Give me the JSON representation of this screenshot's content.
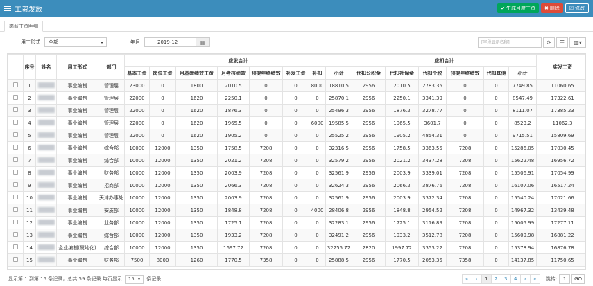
{
  "header": {
    "title": "工资发放",
    "btn_generate": "✔ 生成月度工资",
    "btn_delete": "✖ 删除",
    "btn_edit": "☑ 修改"
  },
  "tabs": [
    {
      "label": "岗薪工资明细"
    }
  ],
  "filters": {
    "employment_label": "用工形式",
    "employment_value": "全部",
    "month_label": "年月",
    "month_value": "2019-12",
    "search_placeholder": "[字段显示名称]"
  },
  "table": {
    "group_headers": {
      "payable": "应发合计",
      "deduct": "应扣合计"
    },
    "headers": {
      "seq": "序号",
      "name": "姓名",
      "employment": "用工形式",
      "dept": "部门",
      "pay": [
        "基本工资",
        "岗位工资",
        "月基础绩效工资",
        "月考核绩效",
        "预提年终绩效",
        "补发工资",
        "补扣",
        "小计"
      ],
      "ded": [
        "代扣公积金",
        "代扣社保金",
        "代扣个税",
        "预提年终绩效",
        "代扣其他",
        "小计"
      ],
      "net": "实发工资"
    },
    "rows": [
      {
        "seq": "1",
        "type": "事业编制",
        "dept": "管理层",
        "pay": [
          "23000",
          "0",
          "1800",
          "2010.5",
          "0",
          "0",
          "8000",
          "18810.5"
        ],
        "ded": [
          "2956",
          "2010.5",
          "2783.35",
          "0",
          "0",
          "7749.85"
        ],
        "net": "11060.65"
      },
      {
        "seq": "2",
        "type": "事业编制",
        "dept": "管理层",
        "pay": [
          "22000",
          "0",
          "1620",
          "2250.1",
          "0",
          "0",
          "0",
          "25870.1"
        ],
        "ded": [
          "2956",
          "2250.1",
          "3341.39",
          "0",
          "0",
          "8547.49"
        ],
        "net": "17322.61"
      },
      {
        "seq": "3",
        "type": "事业编制",
        "dept": "管理层",
        "pay": [
          "22000",
          "0",
          "1620",
          "1876.3",
          "0",
          "0",
          "0",
          "25496.3"
        ],
        "ded": [
          "2956",
          "1876.3",
          "3278.77",
          "0",
          "0",
          "8111.07"
        ],
        "net": "17385.23"
      },
      {
        "seq": "4",
        "type": "事业编制",
        "dept": "管理层",
        "pay": [
          "22000",
          "0",
          "1620",
          "1965.5",
          "0",
          "0",
          "6000",
          "19585.5"
        ],
        "ded": [
          "2956",
          "1965.5",
          "3601.7",
          "0",
          "0",
          "8523.2"
        ],
        "net": "11062.3"
      },
      {
        "seq": "5",
        "type": "事业编制",
        "dept": "管理层",
        "pay": [
          "22000",
          "0",
          "1620",
          "1905.2",
          "0",
          "0",
          "0",
          "25525.2"
        ],
        "ded": [
          "2956",
          "1905.2",
          "4854.31",
          "0",
          "0",
          "9715.51"
        ],
        "net": "15809.69"
      },
      {
        "seq": "6",
        "type": "事业编制",
        "dept": "综合部",
        "pay": [
          "10000",
          "12000",
          "1350",
          "1758.5",
          "7208",
          "0",
          "0",
          "32316.5"
        ],
        "ded": [
          "2956",
          "1758.5",
          "3363.55",
          "7208",
          "0",
          "15286.05"
        ],
        "net": "17030.45"
      },
      {
        "seq": "7",
        "type": "事业编制",
        "dept": "综合部",
        "pay": [
          "10000",
          "12000",
          "1350",
          "2021.2",
          "7208",
          "0",
          "0",
          "32579.2"
        ],
        "ded": [
          "2956",
          "2021.2",
          "3437.28",
          "7208",
          "0",
          "15622.48"
        ],
        "net": "16956.72"
      },
      {
        "seq": "8",
        "type": "事业编制",
        "dept": "财务部",
        "pay": [
          "10000",
          "12000",
          "1350",
          "2003.9",
          "7208",
          "0",
          "0",
          "32561.9"
        ],
        "ded": [
          "2956",
          "2003.9",
          "3339.01",
          "7208",
          "0",
          "15506.91"
        ],
        "net": "17054.99"
      },
      {
        "seq": "9",
        "type": "事业编制",
        "dept": "招商部",
        "pay": [
          "10000",
          "12000",
          "1350",
          "2066.3",
          "7208",
          "0",
          "0",
          "32624.3"
        ],
        "ded": [
          "2956",
          "2066.3",
          "3876.76",
          "7208",
          "0",
          "16107.06"
        ],
        "net": "16517.24"
      },
      {
        "seq": "10",
        "type": "事业编制",
        "dept": "天津办事处",
        "pay": [
          "10000",
          "12000",
          "1350",
          "2003.9",
          "7208",
          "0",
          "0",
          "32561.9"
        ],
        "ded": [
          "2956",
          "2003.9",
          "3372.34",
          "7208",
          "0",
          "15540.24"
        ],
        "net": "17021.66"
      },
      {
        "seq": "11",
        "type": "事业编制",
        "dept": "安质部",
        "pay": [
          "10000",
          "12000",
          "1350",
          "1848.8",
          "7208",
          "0",
          "4000",
          "28406.8"
        ],
        "ded": [
          "2956",
          "1848.8",
          "2954.52",
          "7208",
          "0",
          "14967.32"
        ],
        "net": "13439.48"
      },
      {
        "seq": "12",
        "type": "事业编制",
        "dept": "业务部",
        "pay": [
          "10000",
          "12000",
          "1350",
          "1725.1",
          "7208",
          "0",
          "0",
          "32283.1"
        ],
        "ded": [
          "2956",
          "1725.1",
          "3116.89",
          "7208",
          "0",
          "15005.99"
        ],
        "net": "17277.11"
      },
      {
        "seq": "13",
        "type": "事业编制",
        "dept": "综合部",
        "pay": [
          "10000",
          "12000",
          "1350",
          "1933.2",
          "7208",
          "0",
          "0",
          "32491.2"
        ],
        "ded": [
          "2956",
          "1933.2",
          "3512.78",
          "7208",
          "0",
          "15609.98"
        ],
        "net": "16881.22"
      },
      {
        "seq": "14",
        "type": "企业编制(属地化)",
        "dept": "综合部",
        "pay": [
          "10000",
          "12000",
          "1350",
          "1697.72",
          "7208",
          "0",
          "0",
          "32255.72"
        ],
        "ded": [
          "2820",
          "1997.72",
          "3353.22",
          "7208",
          "0",
          "15378.94"
        ],
        "net": "16876.78"
      },
      {
        "seq": "15",
        "type": "事业编制",
        "dept": "财务部",
        "pay": [
          "7500",
          "8000",
          "1260",
          "1770.5",
          "7358",
          "0",
          "0",
          "25888.5"
        ],
        "ded": [
          "2956",
          "1770.5",
          "2053.35",
          "7358",
          "0",
          "14137.85"
        ],
        "net": "11750.65"
      }
    ]
  },
  "footer": {
    "summary": "显示第 1 到第 15 条记录，总共 59 条记录 每页显示",
    "page_size": "15",
    "suffix": "条记录",
    "pages": [
      "«",
      "‹",
      "1",
      "2",
      "3",
      "4",
      "›",
      "»"
    ],
    "active_page": "1",
    "jump_label": "跳转:",
    "jump_value": "1",
    "go_label": "GO"
  },
  "colors": {
    "primary": "#3c8dbc",
    "success": "#00a65a",
    "danger": "#dd4b39"
  }
}
